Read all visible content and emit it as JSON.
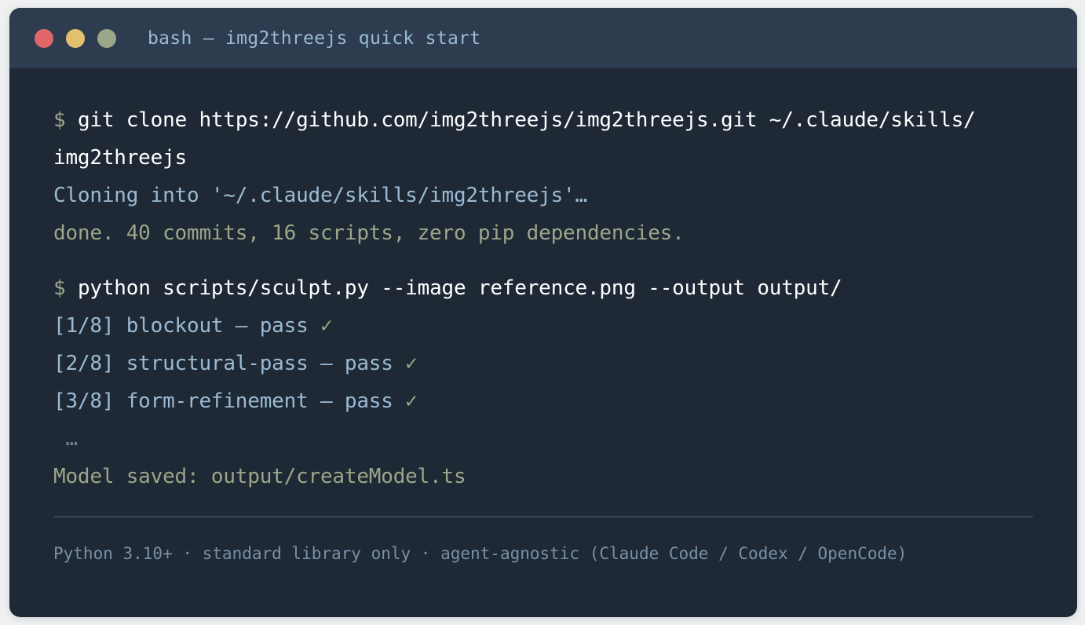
{
  "window": {
    "title": "bash — img2threejs quick start",
    "controls": [
      {
        "name": "close",
        "color": "#e0666a"
      },
      {
        "name": "minimize",
        "color": "#e3c070"
      },
      {
        "name": "maximize",
        "color": "#9aa789"
      }
    ]
  },
  "terminal": {
    "prompt": "$",
    "cmd1": {
      "text_line1": "git clone https://github.com/img2threejs/img2threejs.git ~/.claude/skills/",
      "text_line2": "img2threejs"
    },
    "cloning": "Cloning into '~/.claude/skills/img2threejs'…",
    "done": "done. 40 commits, 16 scripts, zero pip dependencies.",
    "cmd2": "python scripts/sculpt.py --image reference.png --output output/",
    "steps": [
      {
        "text": "[1/8] blockout — pass ",
        "check": "✓"
      },
      {
        "text": "[2/8] structural-pass — pass ",
        "check": "✓"
      },
      {
        "text": "[3/8] form-refinement — pass ",
        "check": "✓"
      }
    ],
    "ellipsis": " …",
    "saved": "Model saved: output/createModel.ts"
  },
  "footer": "Python 3.10+ · standard library only · agent-agnostic (Claude Code / Codex / OpenCode)",
  "colors": {
    "background": "#1f2935",
    "titlebar": "#2d3c4f",
    "command": "#ffffff",
    "info": "#9bbad4",
    "success": "#9aa789"
  }
}
